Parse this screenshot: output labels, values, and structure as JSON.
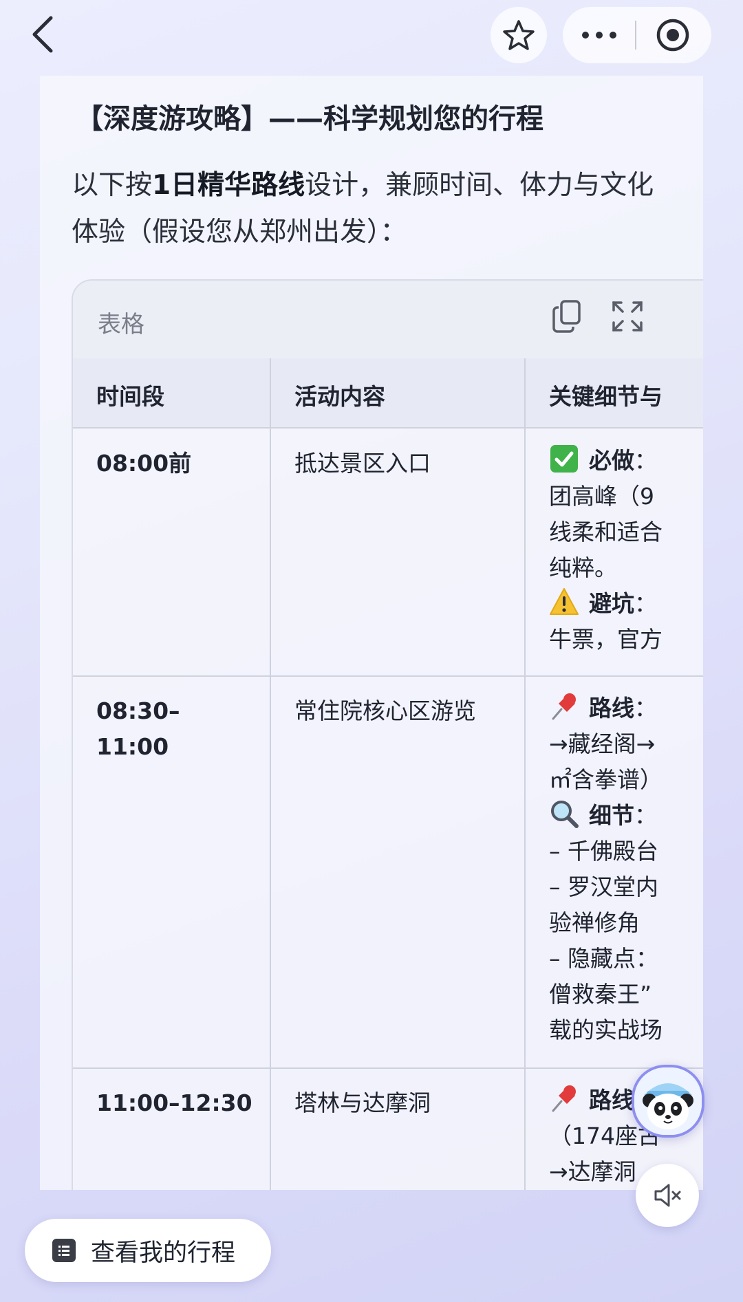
{
  "topbar": {
    "back_icon": "chevron-left-icon",
    "favorite_icon": "star-outline-icon",
    "more_icon": "ellipsis-icon",
    "close_icon": "target-circle-icon"
  },
  "content": {
    "heading": "【深度游攻略】——科学规划您的行程",
    "intro": {
      "prefix": "以下按",
      "bold": "1日精华路线",
      "suffix": "设计，兼顾时间、体力与文化体验（假设您从郑州出发）："
    }
  },
  "table": {
    "title": "表格",
    "copy_icon": "copy-icon",
    "expand_icon": "expand-icon",
    "columns": [
      "时间段",
      "活动内容",
      "关键细节与"
    ],
    "rows": [
      {
        "time": "08:00前",
        "activity": "抵达景区入口",
        "details": [
          {
            "icon": "check-mark-icon",
            "bold": "必做",
            "text": "："
          },
          {
            "text": "团高峰（9"
          },
          {
            "text": "线柔和适合"
          },
          {
            "text": "纯粹。"
          },
          {
            "icon": "warning-icon",
            "bold": "避坑",
            "text": "："
          },
          {
            "text": "牛票，官方"
          }
        ]
      },
      {
        "time_lines": [
          "08:30–",
          "11:00"
        ],
        "activity": "常住院核心区游览",
        "details": [
          {
            "icon": "pushpin-icon",
            "bold": "路线",
            "text": "："
          },
          {
            "text": "→藏经阁→"
          },
          {
            "text": "㎡含拳谱）"
          },
          {
            "icon": "magnifier-icon",
            "bold": "细节",
            "text": "："
          },
          {
            "text": "– 千佛殿台"
          },
          {
            "text": "– 罗汉堂内"
          },
          {
            "text": "验禅修角"
          },
          {
            "text": "– 隐藏点："
          },
          {
            "text": "僧救秦王”"
          },
          {
            "text": "载的实战场"
          }
        ]
      },
      {
        "time": "11:00–12:30",
        "activity": "塔林与达摩洞",
        "details": [
          {
            "icon": "pushpin-icon",
            "bold": "路线",
            "text": "："
          },
          {
            "text": "（174座古"
          },
          {
            "text": "→达摩洞"
          }
        ]
      }
    ]
  },
  "floating": {
    "mascot_icon": "panda-mascot-icon",
    "mute_icon": "speaker-muted-icon",
    "itinerary_icon": "list-icon",
    "itinerary_label": "查看我的行程"
  }
}
